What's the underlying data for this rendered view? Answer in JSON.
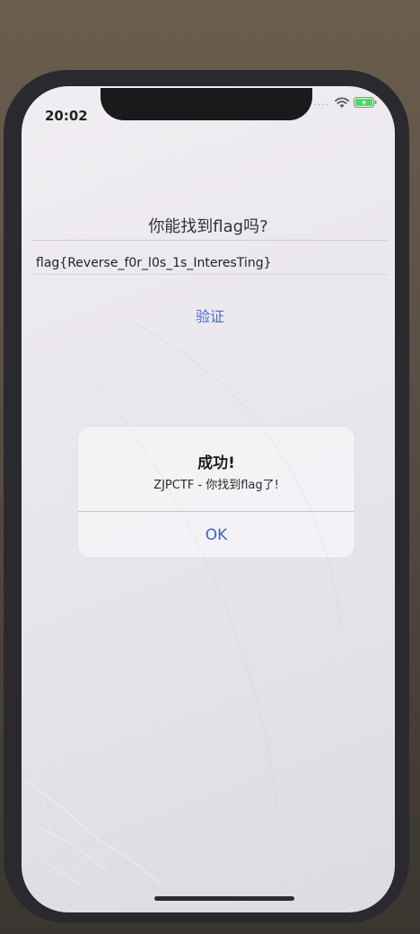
{
  "status_bar": {
    "time": "20:02",
    "signal_dots": "····"
  },
  "main": {
    "question": "你能找到flag吗?",
    "flag_value": "flag{Reverse_f0r_l0s_1s_InteresTing}",
    "verify_label": "验证"
  },
  "alert": {
    "title": "成功!",
    "message": "ZJPCTF - 你找到flag了!",
    "ok_label": "OK"
  },
  "colors": {
    "accent": "#4a6fc2",
    "battery": "#4cd964"
  },
  "icons": {
    "wifi": "wifi-icon",
    "battery": "battery-charging-icon"
  }
}
